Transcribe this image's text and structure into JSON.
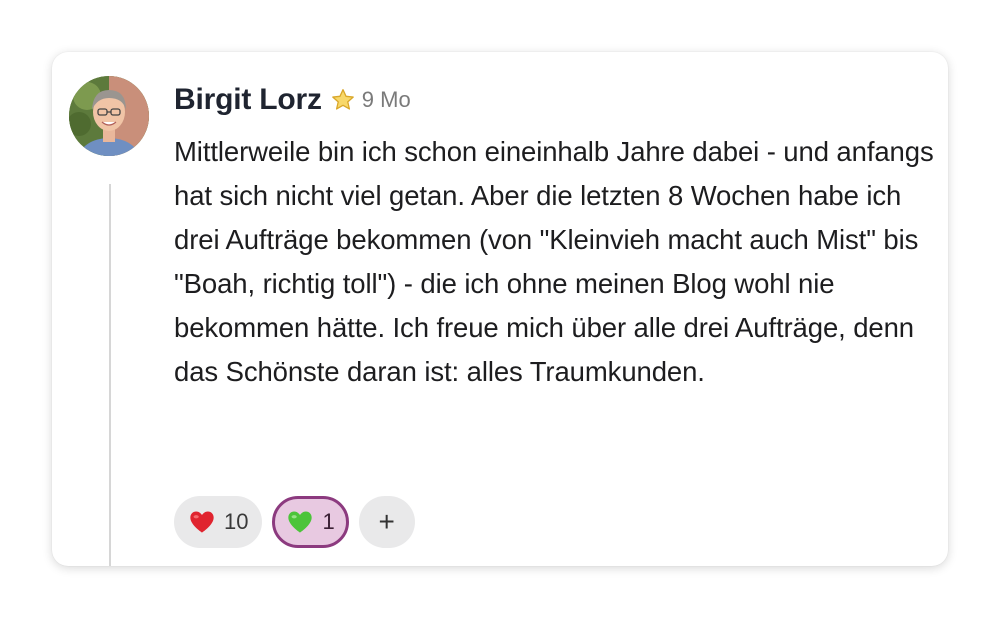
{
  "post": {
    "author": "Birgit Lorz",
    "badge_icon": "star-icon",
    "time": "9 Mo",
    "body": "Mittlerweile bin ich schon eineinhalb Jahre dabei - und anfangs hat sich nicht viel getan. Aber die letzten 8 Wochen habe ich drei Aufträge bekommen (von \"Kleinvieh macht auch Mist\" bis \"Boah, richtig toll\") - die ich ohne meinen Blog wohl nie bekommen hätte. Ich freue mich über alle drei Aufträge, denn das Schönste daran ist: alles Traumkunden."
  },
  "reactions": [
    {
      "icon": "red-heart-icon",
      "count": "10",
      "active": false,
      "color": "#e0242f"
    },
    {
      "icon": "green-heart-icon",
      "count": "1",
      "active": true,
      "color": "#4cc43a"
    }
  ],
  "add_reaction_label": "+",
  "colors": {
    "active_border": "#8c3a7f",
    "active_fill": "#e8c9e1",
    "pill_fill": "#e9e9ea"
  }
}
